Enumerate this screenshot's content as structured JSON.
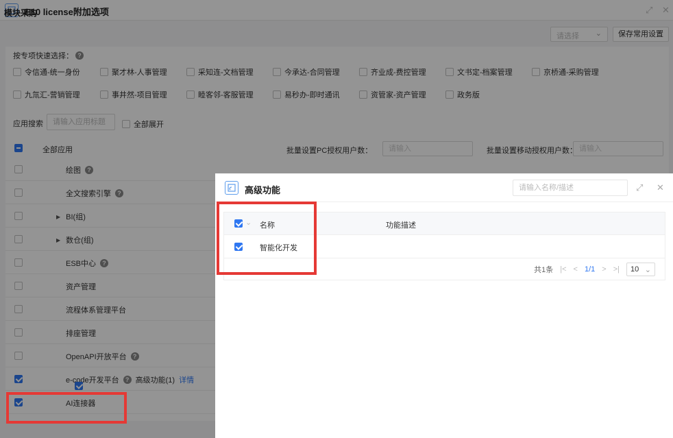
{
  "window": {
    "title": "E10 license附加选项"
  },
  "section": {
    "title": "模块采购",
    "select_placeholder": "请选择",
    "save_label": "保存常用设置"
  },
  "quick": {
    "label": "按专项快速选择：",
    "options": [
      "令信通-统一身份",
      "聚才林-人事管理",
      "采知连-文档管理",
      "今承达-合同管理",
      "齐业成-费控管理",
      "文书定-档案管理",
      "京桥通-采购管理",
      "九氚汇-营销管理",
      "事井然-项目管理",
      "睦客邻-客服管理",
      "易秒办-即时通讯",
      "资管家-资产管理",
      "政务版"
    ]
  },
  "search": {
    "label": "应用搜索",
    "placeholder": "请输入应用标题",
    "expand_label": "全部展开"
  },
  "table": {
    "all_label": "全部应用",
    "batch_pc_label": "批量设置PC授权用户数：",
    "batch_pc_placeholder": "请输入",
    "batch_mobile_label": "批量设置移动授权用户数：",
    "batch_mobile_placeholder": "请输入",
    "rows": [
      {
        "label": "绘图",
        "checked": false
      },
      {
        "label": "全文搜索引擎",
        "checked": false
      },
      {
        "label": "BI(组)",
        "checked": false
      },
      {
        "label": "数仓(组)",
        "checked": false
      },
      {
        "label": "ESB中心",
        "checked": false
      },
      {
        "label": "资产管理",
        "checked": false
      },
      {
        "label": "流程体系管理平台",
        "checked": false
      },
      {
        "label": "排座管理",
        "checked": false
      },
      {
        "label": "OpenAPI开放平台",
        "checked": false
      },
      {
        "label": "e-code开发平台",
        "checked": true,
        "sub_label": "高级功能(1)",
        "detail": "详情"
      },
      {
        "label": "AI连接器",
        "checked": true
      }
    ]
  },
  "dialog": {
    "title": "高级功能",
    "search_placeholder": "请输入名称/描述",
    "col_name": "名称",
    "col_desc": "功能描述",
    "rows": [
      {
        "name": "智能化开发",
        "desc": ""
      }
    ],
    "total": "共1条",
    "page": "1/1",
    "page_size": "10"
  },
  "colors": {
    "accent": "#2f77f1",
    "highlight": "#e53935"
  }
}
